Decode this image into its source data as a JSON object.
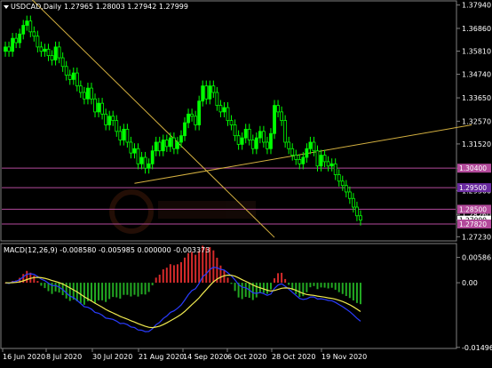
{
  "header": {
    "symbol_timeframe": "USDCAD,Daily",
    "ohlc": "1.27965 1.28003 1.27942 1.27999"
  },
  "indicator": {
    "label": "MACD(12,26,9) -0.008580 -0.005985 0.000000 -0.003373"
  },
  "colors": {
    "background": "#000000",
    "bull_candle": "#00ff00",
    "bear_candle": "#ffffff",
    "trendline": "#d4b040",
    "level_lines": "#b34a9b",
    "macd_positive": "#d42a2a",
    "macd_negative": "#22a822",
    "macd_main": "#2a3cff",
    "macd_signal": "#f0ea50"
  },
  "chart_data": {
    "type": "candlestick",
    "price_axis": {
      "ylim": [
        1.2708,
        1.3809
      ],
      "ticks": [
        "1.37940",
        "1.36860",
        "1.35810",
        "1.34740",
        "1.33650",
        "1.32570",
        "1.31520",
        "1.30400",
        "1.29360",
        "1.28260",
        "1.27999",
        "1.27230"
      ]
    },
    "tags": [
      {
        "text": "1.30400",
        "value": 1.304,
        "bg": "#b34a9b",
        "fg": "#ffffff"
      },
      {
        "text": "1.29500",
        "value": 1.295,
        "bg": "#6a2aa0",
        "fg": "#ffffff"
      },
      {
        "text": "1.28500",
        "value": 1.285,
        "bg": "#b34a9b",
        "fg": "#ffffff"
      },
      {
        "text": "1.27999",
        "value": 1.27999,
        "bg": "#ffffff",
        "fg": "#000000"
      },
      {
        "text": "1.27820",
        "value": 1.2782,
        "bg": "#b34a9b",
        "fg": "#ffffff"
      }
    ],
    "levels": [
      1.304,
      1.295,
      1.285,
      1.2782
    ],
    "x_axis": [
      "16 Jun 2020",
      "8 Jul 2020",
      "30 Jul 2020",
      "21 Aug 2020",
      "14 Sep 2020",
      "6 Oct 2020",
      "28 Oct 2020",
      "19 Nov 2020"
    ],
    "trendlines": [
      {
        "from": [
          0,
          1.394
        ],
        "to": [
          75,
          1.272
        ]
      },
      {
        "from": [
          36,
          1.297
        ],
        "to": [
          130,
          1.324
        ]
      }
    ],
    "candles_close": [
      1.36,
      1.358,
      1.364,
      1.362,
      1.366,
      1.37,
      1.372,
      1.367,
      1.365,
      1.36,
      1.358,
      1.359,
      1.356,
      1.354,
      1.36,
      1.355,
      1.351,
      1.347,
      1.345,
      1.348,
      1.342,
      1.339,
      1.336,
      1.341,
      1.336,
      1.33,
      1.334,
      1.329,
      1.324,
      1.328,
      1.326,
      1.321,
      1.317,
      1.322,
      1.316,
      1.311,
      1.313,
      1.306,
      1.309,
      1.304,
      1.306,
      1.312,
      1.316,
      1.312,
      1.317,
      1.314,
      1.318,
      1.313,
      1.316,
      1.319,
      1.325,
      1.329,
      1.328,
      1.324,
      1.335,
      1.342,
      1.336,
      1.342,
      1.339,
      1.333,
      1.33,
      1.332,
      1.326,
      1.324,
      1.319,
      1.315,
      1.318,
      1.322,
      1.317,
      1.313,
      1.318,
      1.321,
      1.316,
      1.313,
      1.32,
      1.333,
      1.33,
      1.326,
      1.316,
      1.313,
      1.31,
      1.308,
      1.306,
      1.309,
      1.313,
      1.316,
      1.312,
      1.305,
      1.31,
      1.307,
      1.305,
      1.306,
      1.301,
      1.298,
      1.296,
      1.293,
      1.29,
      1.286,
      1.282,
      1.28
    ],
    "macd": {
      "ylim": [
        -0.0148,
        0.0066
      ],
      "ticks": [
        "0.00586",
        "0.00",
        "-0.01496"
      ]
    }
  }
}
